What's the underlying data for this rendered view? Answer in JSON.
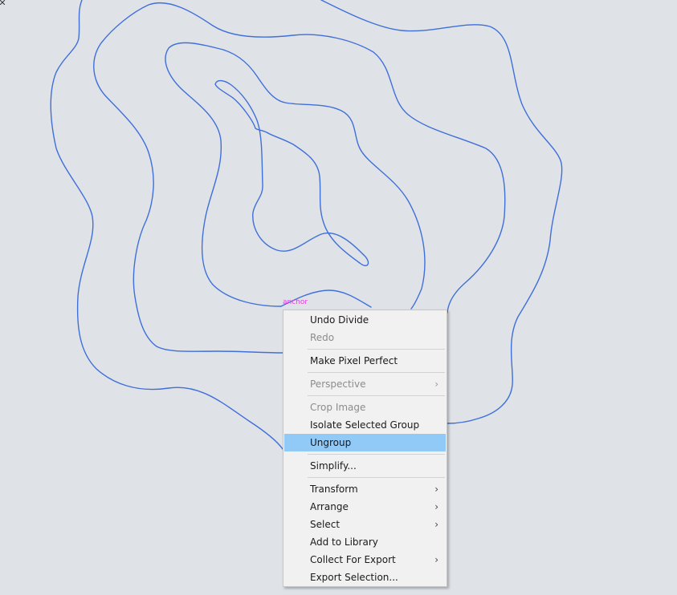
{
  "canvas": {
    "anchor_label": "anchor",
    "stroke_color": "#3f6fd9",
    "background_color": "#dfe3e8"
  },
  "context_menu": {
    "items": [
      {
        "label": "Undo Divide",
        "enabled": true
      },
      {
        "label": "Redo",
        "enabled": false
      },
      {
        "label": "Make Pixel Perfect",
        "enabled": true
      },
      {
        "label": "Perspective",
        "enabled": false,
        "submenu": true
      },
      {
        "label": "Crop Image",
        "enabled": false
      },
      {
        "label": "Isolate Selected Group",
        "enabled": true
      },
      {
        "label": "Ungroup",
        "enabled": true,
        "highlighted": true
      },
      {
        "label": "Simplify...",
        "enabled": true
      },
      {
        "label": "Transform",
        "enabled": true,
        "submenu": true
      },
      {
        "label": "Arrange",
        "enabled": true,
        "submenu": true
      },
      {
        "label": "Select",
        "enabled": true,
        "submenu": true
      },
      {
        "label": "Add to Library",
        "enabled": true
      },
      {
        "label": "Collect For Export",
        "enabled": true,
        "submenu": true
      },
      {
        "label": "Export Selection...",
        "enabled": true
      }
    ],
    "submenu_glyph": "›",
    "highlight_color": "#91c9f7"
  }
}
